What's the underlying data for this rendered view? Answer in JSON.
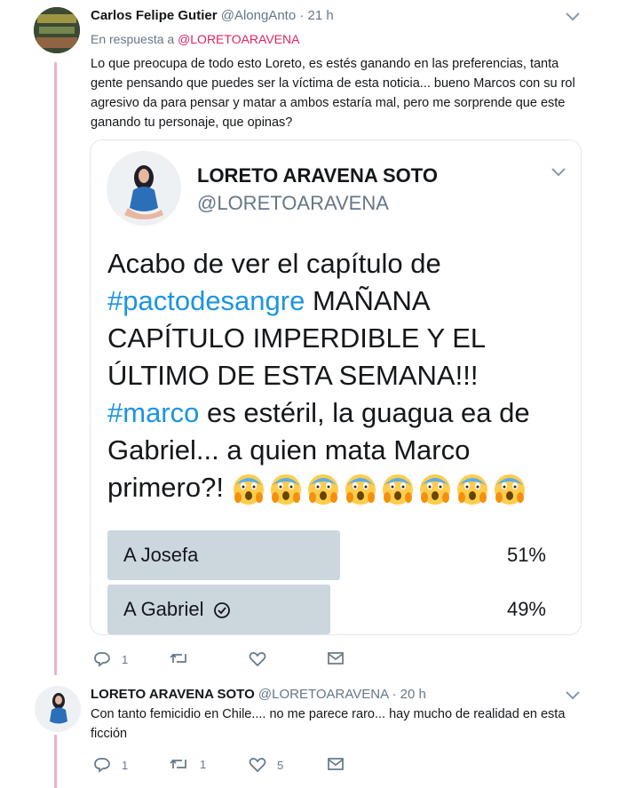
{
  "colors": {
    "thread_line": "#e8b5c7",
    "mention": "#e0245e",
    "hashtag": "#1b95e0",
    "muted": "#657786",
    "poll_bar": "#ccd6dd"
  },
  "tweet1": {
    "name": "Carlos Felipe Gutier",
    "handle": "@AlongAnto",
    "dot": "·",
    "time": "21 h",
    "reply_prefix": "En respuesta a",
    "reply_mention": "@LORETOARAVENA",
    "text": "Lo que  preocupa de todo esto Loreto, es estés ganando en las preferencias, tanta gente pensando que puedes ser la víctima de esta noticia... bueno Marcos con su rol agresivo da para pensar y matar a ambos estaría mal, pero me sorprende que este ganando tu personaje, que opinas?",
    "actions": {
      "reply_count": "1",
      "retweet_count": "",
      "like_count": ""
    }
  },
  "quote": {
    "name": "LORETO ARAVENA SOTO",
    "handle": "@LORETOARAVENA",
    "text_part1": "Acabo de ver el capítulo de ",
    "hashtag1": "#pactodesangre",
    "text_part2": " MAÑANA CAPÍTULO IMPERDIBLE Y EL ÚLTIMO DE ESTA SEMANA!!! ",
    "hashtag2": "#marco",
    "text_part3": " es estéril, la guagua ea de Gabriel... a quien mata Marco primero?! ",
    "emoji_names": [
      "scream-face-icon",
      "scream-face-icon",
      "scream-face-icon",
      "scream-face-icon",
      "scream-face-icon",
      "scream-face-icon",
      "scream-face-icon",
      "scream-face-icon"
    ],
    "poll": [
      {
        "label": "A Josefa",
        "percent": "51%",
        "value": 51,
        "selected": false
      },
      {
        "label": "A Gabriel",
        "percent": "49%",
        "value": 49,
        "selected": true
      }
    ]
  },
  "tweet2": {
    "name": "LORETO ARAVENA SOTO",
    "handle": "@LORETOARAVENA",
    "dot": "·",
    "time": "20 h",
    "text": "Con tanto femicidio en Chile.... no me parece raro... hay mucho de realidad en esta ficción",
    "actions": {
      "reply_count": "1",
      "retweet_count": "1",
      "like_count": "5"
    }
  }
}
